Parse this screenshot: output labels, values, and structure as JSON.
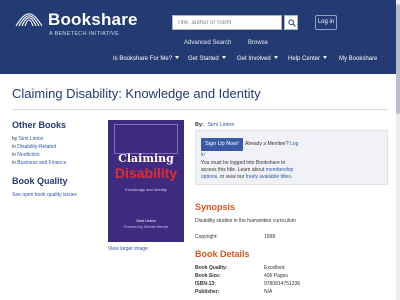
{
  "header": {
    "logo_text": "Bookshare",
    "logo_tagline": "A BENETECH INITIATIVE",
    "search": {
      "placeholder": "Title, author or ISBN"
    },
    "login_label": "Log in",
    "top_links": [
      "Advanced Search",
      "Browse"
    ],
    "nav": [
      "Is Bookshare For Me?",
      "Get Started",
      "Get Involved",
      "Help Center",
      "My Bookshare"
    ]
  },
  "page": {
    "title": "Claiming Disability: Knowledge and Identity"
  },
  "sidebar": {
    "other_books_heading": "Other Books",
    "lines": [
      {
        "prefix": "by",
        "link": "Simi Linton"
      },
      {
        "prefix": "in",
        "link": "Disability-Related"
      },
      {
        "prefix": "in",
        "link": "Nonfiction"
      },
      {
        "prefix": "in",
        "link": "Business and Finance"
      }
    ],
    "quality_heading": "Book Quality",
    "quality_link": "See open book quality issues"
  },
  "cover": {
    "title_line1": "Claiming",
    "title_line2": "Disability",
    "subtitle": "Knowledge and Identity",
    "author": "Simi Linton",
    "foreword": "Foreword by Michael Berube",
    "view_larger": "View larger image"
  },
  "details": {
    "by_label": "By:",
    "author": "Simi Linton",
    "signup_label": "Sign Up Now!",
    "already_member": "Already a Member?",
    "login_link_a": "Log",
    "login_link_b": "in",
    "notice_1": "You must be logged into Bookshare to",
    "notice_2": "access this title. Learn about",
    "notice_link_1": "membership",
    "notice_link_2": "options,",
    "notice_3": "or view our",
    "notice_link_3": "freely available titles",
    "notice_end": ".",
    "synopsis_heading": "Synopsis",
    "synopsis_text": "Disability studies in the humanities curriculum",
    "copyright_label": "Copyright:",
    "copyright_value": "1998",
    "book_details_heading": "Book Details",
    "rows": [
      {
        "label": "Book Quality:",
        "value": "Excellent"
      },
      {
        "label": "Book Size:",
        "value": "406 Pages"
      },
      {
        "label": "ISBN-13:",
        "value": "9780814751336"
      },
      {
        "label": "Publisher:",
        "value": "N/A"
      }
    ]
  },
  "colors": {
    "header_bg": "#243a73",
    "title_blue": "#243a73",
    "accent_orange": "#d4591f",
    "link_blue": "#2e58a8",
    "cover_purple": "#3d2b80",
    "cover_red": "#e32d2d"
  },
  "icons": [
    "bookshare-logo-icon",
    "search-icon",
    "chevron-down-icon"
  ]
}
